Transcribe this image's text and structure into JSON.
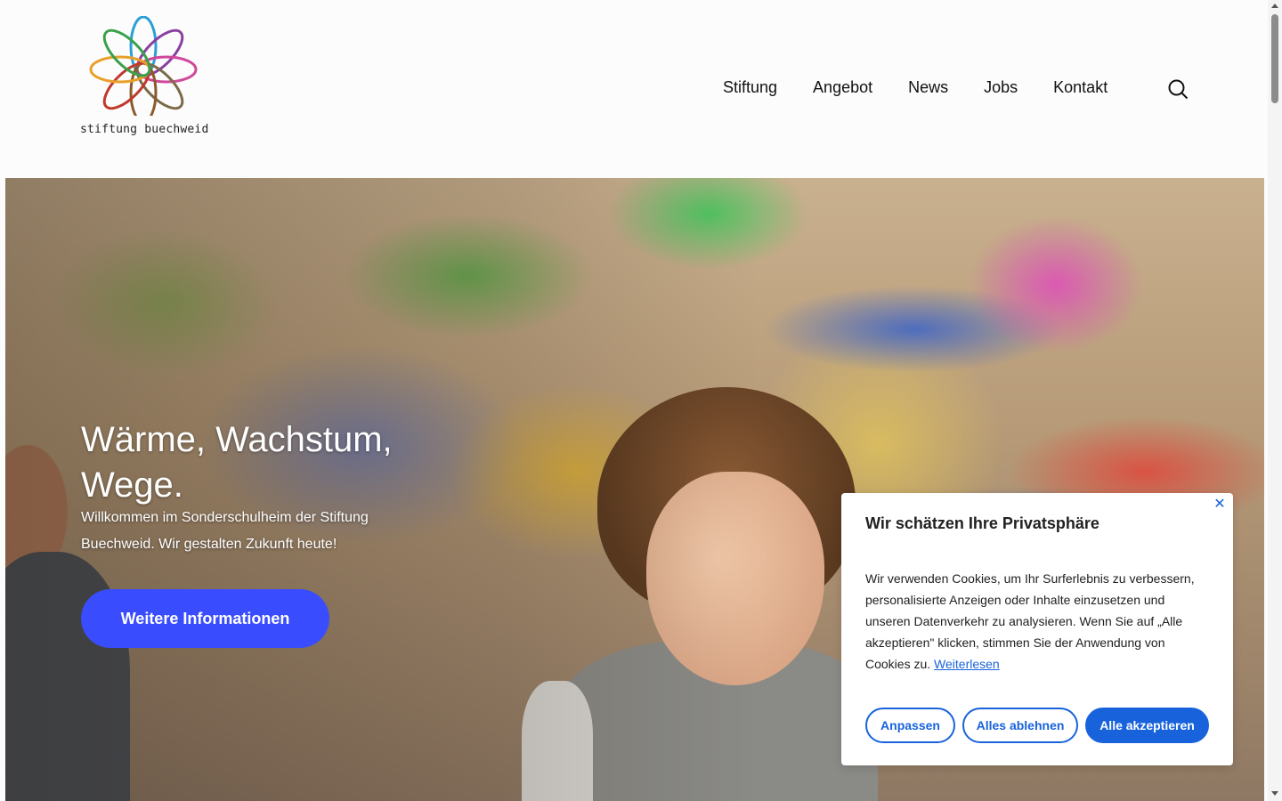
{
  "brand": {
    "name": "stiftung buechweid"
  },
  "nav": {
    "items": [
      "Stiftung",
      "Angebot",
      "News",
      "Jobs",
      "Kontakt"
    ]
  },
  "hero": {
    "title": "Wärme, Wachstum,\nWege.",
    "subtitle": "Willkommen im Sonderschulheim der Stiftung Buechweid. Wir gestalten Zukunft heute!",
    "button": "Weitere Informationen"
  },
  "cookie": {
    "title": "Wir schätzen Ihre Privatsphäre",
    "text": "Wir verwenden Cookies, um Ihr Surferlebnis zu verbessern, personalisierte Anzeigen oder Inhalte einzusetzen und unseren Datenverkehr zu analysieren. Wenn Sie auf „Alle akzeptieren\" klicken, stimmen Sie der Anwendung von Cookies zu.",
    "link": "Weiterlesen",
    "buttons": {
      "customize": "Anpassen",
      "reject": "Alles ablehnen",
      "accept": "Alle akzeptieren"
    }
  },
  "colors": {
    "accent": "#3a4dfe",
    "cookie_accent": "#1863dc"
  }
}
